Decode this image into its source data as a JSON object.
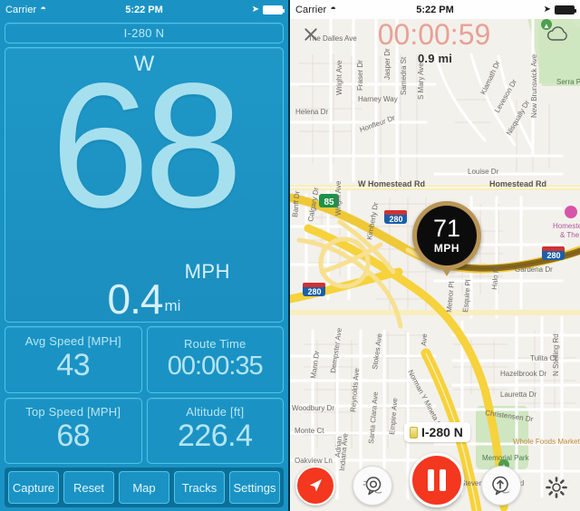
{
  "left_phone": {
    "statusbar": {
      "carrier": "Carrier",
      "wifi_icon": "wifi-icon",
      "time": "5:22 PM",
      "location_icon": "location-arrow-icon",
      "battery_icon": "battery-full-icon"
    },
    "road_banner": "I-280 N",
    "speed_panel": {
      "heading": "W",
      "speed": "68",
      "speed_unit": "MPH",
      "distance": "0.4",
      "distance_unit": "mi"
    },
    "stats": [
      {
        "label": "Avg Speed [MPH]",
        "value": "43"
      },
      {
        "label": "Route Time",
        "value": "00:00:35"
      },
      {
        "label": "Top Speed [MPH]",
        "value": "68"
      },
      {
        "label": "Altitude [ft]",
        "value": "226.4"
      }
    ],
    "toolbar": [
      {
        "label": "Capture"
      },
      {
        "label": "Reset"
      },
      {
        "label": "Map"
      },
      {
        "label": "Tracks"
      },
      {
        "label": "Settings"
      }
    ],
    "colors": {
      "panel_bg": "#1a93c4",
      "card_border": "#4fc3e8",
      "toolbar_bg": "#0b6f98",
      "text_light": "#b5e4f2"
    }
  },
  "right_phone": {
    "statusbar": {
      "carrier": "Carrier",
      "wifi_icon": "wifi-icon",
      "time": "5:22 PM",
      "location_icon": "location-arrow-icon",
      "battery_icon": "battery-full-icon"
    },
    "close_icon": "close-x-icon",
    "timer": "00:00:59",
    "cloud_icon": "cloud-icon",
    "distance_remaining": "0.9 mi",
    "speed_bubble": {
      "value": "71",
      "unit": "MPH"
    },
    "road_label": "I-280 N",
    "controls": [
      {
        "name": "navigate-button",
        "icon": "navigation-arrow-icon"
      },
      {
        "name": "report-button",
        "icon": "report-speech-bubble-icon"
      },
      {
        "name": "pause-button",
        "icon": "pause-icon"
      },
      {
        "name": "share-location-button",
        "icon": "share-up-arrow-icon"
      },
      {
        "name": "settings-button",
        "icon": "gear-icon"
      }
    ],
    "colors": {
      "accent_red": "#f4371f",
      "timer_color": "#e8a195",
      "bubble_ring": "#b99555",
      "map_bg": "#f3f1ec",
      "highway_yellow": "#f6d23c",
      "route_brown": "#8a6a1e",
      "park_green": "#cfe6c0"
    },
    "map_labels": [
      "The Dalles Ave",
      "Wright Ave",
      "Fraser Dr",
      "Jasper Dr",
      "Samedra St",
      "S Mary Ave",
      "Harney Way",
      "Helena Dr",
      "Honfleur Dr",
      "Klamath Dr",
      "Leveson Dr",
      "Nisqually Dr",
      "New Brunswick Ave",
      "Serra Park",
      "Louise Dr",
      "W Homestead Rd",
      "Homestead Rd",
      "Banff Dr",
      "Calgary Dr",
      "Kimberly Dr",
      "Gardena Dr",
      "Halo Pl",
      "Esquire Pl",
      "Meteor Pl",
      "Homestead & The",
      "Tulita Ct",
      "Hazelbrook Dr",
      "Lauretta Dr",
      "Christensen Dr",
      "N Stelling Rd",
      "Memorial Park",
      "Whole Foods Market",
      "Stevens Creek Blvd",
      "Oakview Ln",
      "Woodbury Dr",
      "Monte Ct",
      "Mann Dr",
      "Dempster Ave",
      "Reynolds Ave",
      "Stokes Ave",
      "Santa Clara Ave",
      "Empire Ave",
      "Indiana Ave",
      "Norman Y Mineta Hwy",
      "Adrian",
      "85",
      "280"
    ]
  }
}
